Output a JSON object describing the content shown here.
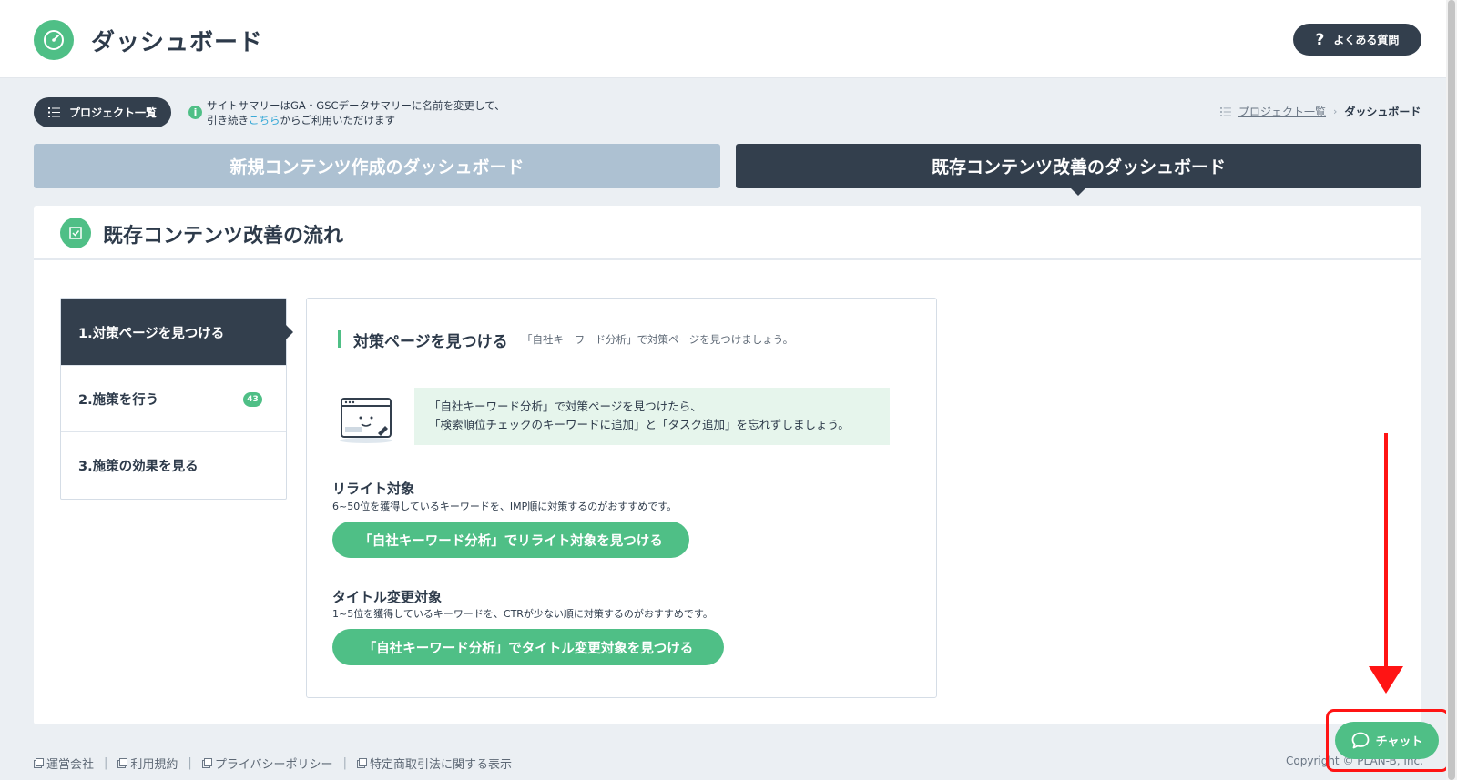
{
  "header": {
    "title": "ダッシュボード",
    "faq_label": "よくある質問"
  },
  "toolbar": {
    "project_list_label": "プロジェクト一覧",
    "notice_line1": "サイトサマリーはGA・GSCデータサマリーに名前を変更して、",
    "notice_line2_prefix": "引き続き",
    "notice_link": "こちら",
    "notice_line2_suffix": "からご利用いただけます"
  },
  "breadcrumb": {
    "parent": "プロジェクト一覧",
    "current": "ダッシュボード"
  },
  "dashboard_tabs": {
    "new_content": "新規コンテンツ作成のダッシュボード",
    "existing_content": "既存コンテンツ改善のダッシュボード",
    "active": "existing_content"
  },
  "panel": {
    "title": "既存コンテンツ改善の流れ"
  },
  "steps": [
    {
      "label": "1.対策ページを見つける",
      "active": true
    },
    {
      "label": "2.施策を行う",
      "badge": "43"
    },
    {
      "label": "3.施策の効果を見る"
    }
  ],
  "content": {
    "section_title": "対策ページを見つける",
    "section_subtitle": "「自社キーワード分析」で対策ページを見つけましょう。",
    "tip_line1": "「自社キーワード分析」で対策ページを見つけたら、",
    "tip_line2": "「検索順位チェックのキーワードに追加」と「タスク追加」を忘れずしましょう。",
    "rewrite": {
      "title": "リライト対象",
      "desc": "6~50位を獲得しているキーワードを、IMP順に対策するのがおすすめです。",
      "button": "「自社キーワード分析」でリライト対象を見つける"
    },
    "title_change": {
      "title": "タイトル変更対象",
      "desc": "1~5位を獲得しているキーワードを、CTRが少ない順に対策するのがおすすめです。",
      "button": "「自社キーワード分析」でタイトル変更対象を見つける"
    }
  },
  "footer": {
    "links": [
      "運営会社",
      "利用規約",
      "プライバシーポリシー",
      "特定商取引法に関する表示"
    ],
    "copyright": "Copyright © PLAN-B, Inc."
  },
  "chat": {
    "label": "チャット"
  },
  "colors": {
    "brand_green": "#4fbf86",
    "dark_navy": "#333f4d",
    "inactive_tab": "#adc1d2",
    "annotation_red": "#ff1414"
  }
}
